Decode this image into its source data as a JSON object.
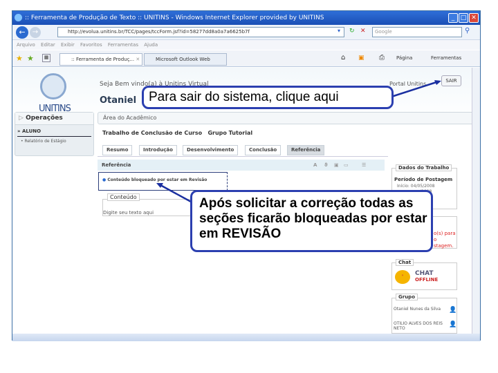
{
  "browser": {
    "title": ":: Ferramenta de Produção de Texto :: UNITINS - Windows Internet Explorer provided by UNITINS",
    "url": "http://evolua.unitins.br/TCC/pages/tccForm.jsf?id=58277dd8a0a7a6625b7f",
    "search_placeholder": "Google",
    "menu": [
      "Arquivo",
      "Editar",
      "Exibir",
      "Favoritos",
      "Ferramentas",
      "Ajuda"
    ],
    "tabs": [
      ":: Ferramenta de Produç...",
      "Microsoft Outlook Web Access"
    ],
    "toolbar": {
      "page": "Página",
      "tools": "Ferramentas"
    }
  },
  "header": {
    "logo": "UNITINS",
    "welcome": "Seja Bem vindo(a) à Unitins Virtual",
    "user": "Otaniel",
    "portal": "Portal Unitins",
    "logout": "SAIR"
  },
  "sidebar": {
    "title": "Operações",
    "section": "ALUNO",
    "items": [
      "Relatório de Estágio"
    ]
  },
  "main": {
    "area": "Área do Acadêmico",
    "course": "Trabalho de Conclusão de Curso",
    "group": "Grupo Tutorial",
    "tabs": [
      "Resumo",
      "Introdução",
      "Desenvolvimento",
      "Conclusão",
      "Referência"
    ],
    "section_title": "Referência",
    "blocked_msg": "Conteúdo bloqueado por estar em Revisão",
    "content_legend": "Conteúdo",
    "content_placeholder": "Digite seu texto aqui"
  },
  "right": {
    "dados_title": "Dados do Trabalho",
    "periodo": "Período de Postagem",
    "inicio": "Início: 04/05/2008",
    "fim": "/2008",
    "warn": [
      "o(s) para",
      "o",
      "stagem."
    ],
    "chat_title": "Chat",
    "chat_status": [
      "CHAT",
      "OFFLINE"
    ],
    "grupo_title": "Grupo",
    "members": [
      "Otaniel Nunes da Silva",
      "OTILIO ALVES DOS REIS NETO"
    ]
  },
  "callouts": {
    "logout": "Para sair do sistema, clique aqui",
    "revision": "Após solicitar a correção todas as seções ficarão bloqueadas por estar em REVISÃO"
  }
}
